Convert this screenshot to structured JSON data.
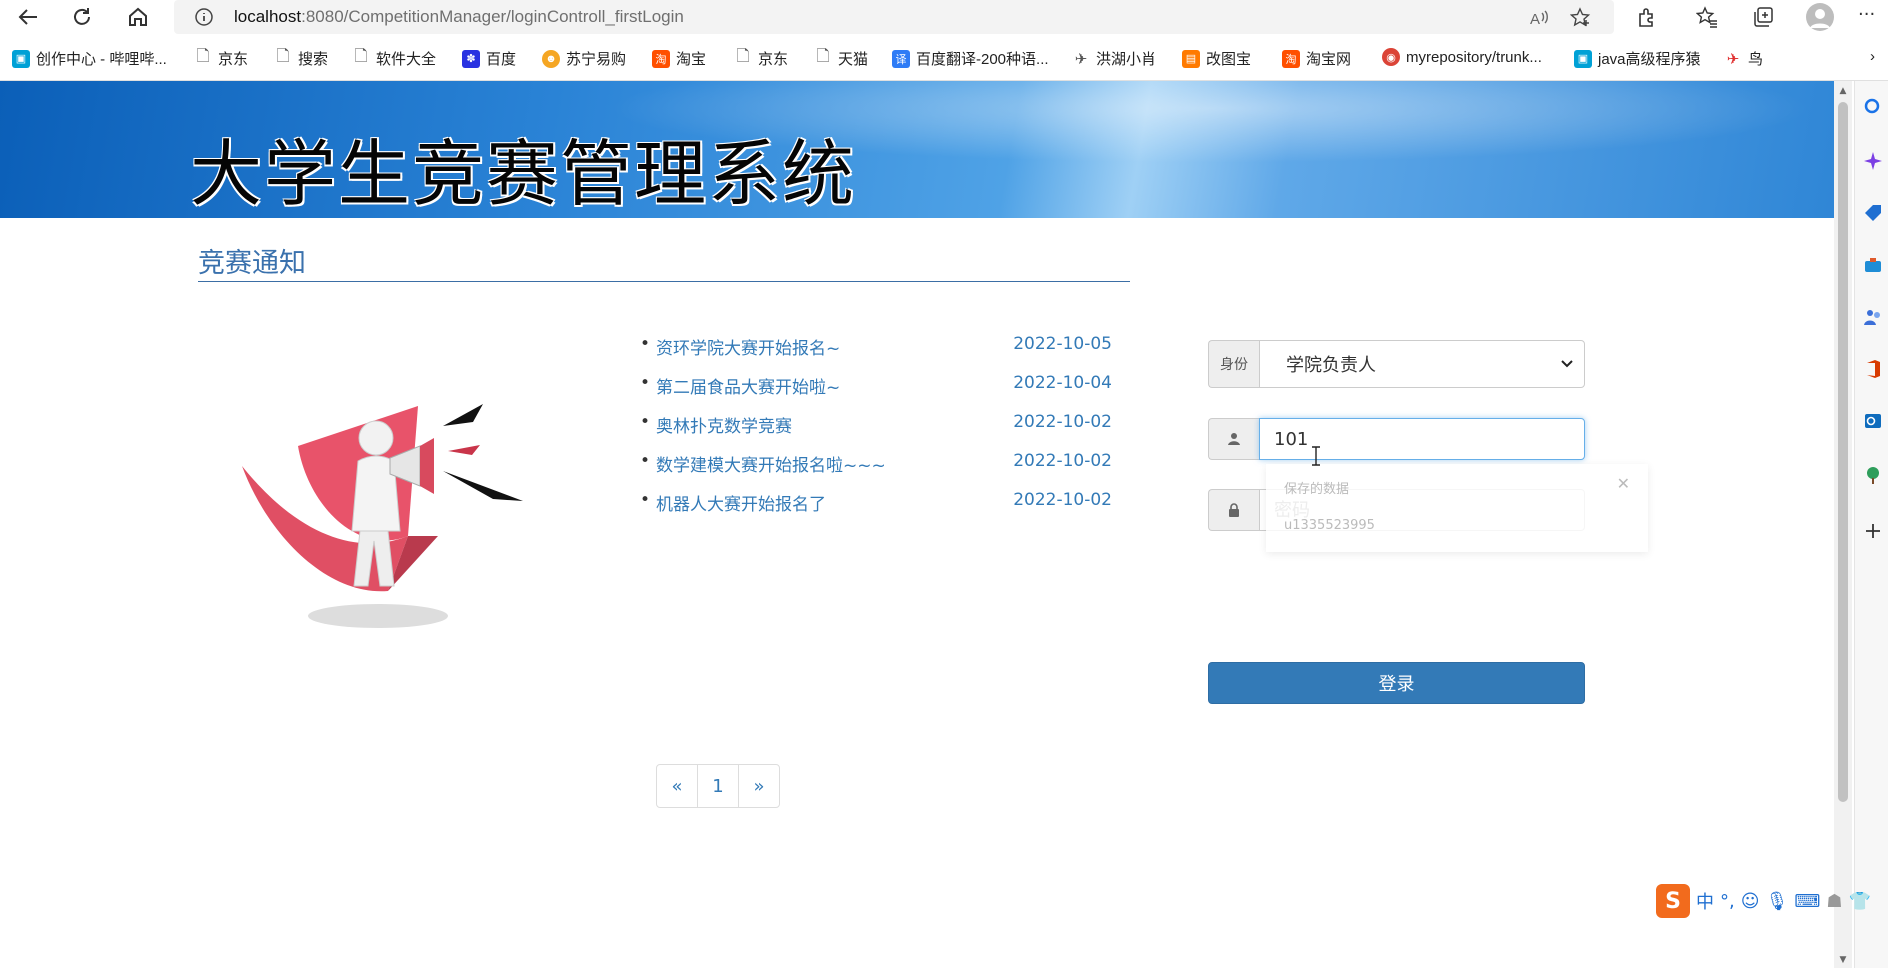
{
  "browser": {
    "url_host": "localhost",
    "url_path": ":8080/CompetitionManager/loginControll_firstLogin",
    "more_label": "···"
  },
  "bookmarks": [
    {
      "label": "创作中心 - 哔哩哔...",
      "icon": "bilibili-icon",
      "color": "#00a1d6"
    },
    {
      "label": "京东",
      "icon": "page-icon",
      "color": "#666666"
    },
    {
      "label": "搜索",
      "icon": "page-icon",
      "color": "#666666"
    },
    {
      "label": "软件大全",
      "icon": "page-icon",
      "color": "#666666"
    },
    {
      "label": "百度",
      "icon": "baidu-icon",
      "color": "#2932e1"
    },
    {
      "label": "苏宁易购",
      "icon": "suning-icon",
      "color": "#f5a623"
    },
    {
      "label": "淘宝",
      "icon": "taobao-icon",
      "color": "#ff5000"
    },
    {
      "label": "京东",
      "icon": "page-icon",
      "color": "#666666"
    },
    {
      "label": "天猫",
      "icon": "page-icon",
      "color": "#666666"
    },
    {
      "label": "百度翻译-200种语...",
      "icon": "translate-icon",
      "color": "#2f7cf6"
    },
    {
      "label": "洪湖小肖",
      "icon": "bird-icon",
      "color": "#555555"
    },
    {
      "label": "改图宝",
      "icon": "gaitubao-icon",
      "color": "#ff7a00"
    },
    {
      "label": "淘宝网",
      "icon": "taobao-icon",
      "color": "#ff5000"
    },
    {
      "label": "myrepository/trunk...",
      "icon": "chrome-icon",
      "color": "#db4437"
    },
    {
      "label": "java高级程序猿",
      "icon": "bilibili-icon",
      "color": "#00a1d6"
    },
    {
      "label": "鸟",
      "icon": "bird-icon",
      "color": "#e03030"
    }
  ],
  "page": {
    "site_title": "大学生竞赛管理系统",
    "notice_heading": "竞赛通知",
    "notices": [
      {
        "title": "资环学院大赛开始报名~",
        "date": "2022-10-05"
      },
      {
        "title": "第二届食品大赛开始啦~",
        "date": "2022-10-04"
      },
      {
        "title": "奥林扑克数学竞赛",
        "date": "2022-10-02"
      },
      {
        "title": "数学建模大赛开始报名啦~~~",
        "date": "2022-10-02"
      },
      {
        "title": "机器人大赛开始报名了",
        "date": "2022-10-02"
      }
    ],
    "pagination": [
      "«",
      "1",
      "»"
    ]
  },
  "login": {
    "role_label": "身份",
    "role_value": "学院负责人",
    "username_value": "101",
    "password_placeholder": "密码",
    "autofill_title": "保存的数据",
    "autofill_user": "u1335523995",
    "submit_label": "登录"
  },
  "ime": {
    "logo": "S",
    "mode": "中",
    "punct": "°,"
  }
}
